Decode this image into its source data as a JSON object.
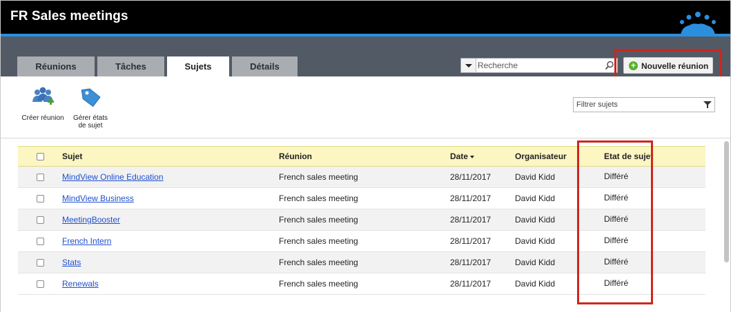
{
  "app": {
    "title": "FR Sales meetings"
  },
  "tabs": [
    {
      "label": "Réunions"
    },
    {
      "label": "Tâches"
    },
    {
      "label": "Sujets"
    },
    {
      "label": "Détails"
    }
  ],
  "active_tab": "Sujets",
  "search": {
    "placeholder": "Recherche",
    "value": ""
  },
  "new_meeting": {
    "label": "Nouvelle réunion"
  },
  "toolbar": {
    "create_meeting": "Créer réunion",
    "manage_states_line1": "Gérer états",
    "manage_states_line2": "de sujet",
    "filter_placeholder": "Filtrer sujets"
  },
  "table": {
    "headers": {
      "subject": "Sujet",
      "meeting": "Réunion",
      "date": "Date",
      "organizer": "Organisateur",
      "state": "Etat de sujet"
    },
    "rows": [
      {
        "subject": "MindView Online Education",
        "meeting": "French sales meeting",
        "date": "28/11/2017",
        "organizer": "David Kidd",
        "state": "Différé"
      },
      {
        "subject": "MindView Business",
        "meeting": "French sales meeting",
        "date": "28/11/2017",
        "organizer": "David Kidd",
        "state": "Différé"
      },
      {
        "subject": "MeetingBooster",
        "meeting": "French sales meeting",
        "date": "28/11/2017",
        "organizer": "David Kidd",
        "state": "Différé"
      },
      {
        "subject": "French Intern",
        "meeting": "French sales meeting",
        "date": "28/11/2017",
        "organizer": "David Kidd",
        "state": "Différé"
      },
      {
        "subject": "Stats",
        "meeting": "French sales meeting",
        "date": "28/11/2017",
        "organizer": "David Kidd",
        "state": "Différé"
      },
      {
        "subject": "Renewals",
        "meeting": "French sales meeting",
        "date": "28/11/2017",
        "organizer": "David Kidd",
        "state": "Différé"
      }
    ]
  },
  "colors": {
    "accent": "#2b8fe0",
    "highlight": "#d0251b",
    "header_bg": "#fbf6c2",
    "link": "#1f4fcf"
  }
}
